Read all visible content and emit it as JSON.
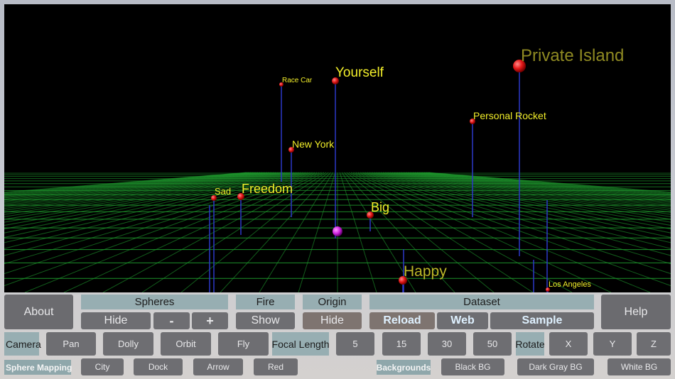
{
  "scene": {
    "spheres": [
      {
        "label": "Private Island",
        "color": "#8f8a22",
        "size": 24
      },
      {
        "label": "Yourself",
        "color": "#f2ee2a",
        "size": 19
      },
      {
        "label": "Race Car",
        "color": "#f2ee2a",
        "size": 10
      },
      {
        "label": "Personal Rocket",
        "color": "#f2ee2a",
        "size": 14
      },
      {
        "label": "New York",
        "color": "#f2ee2a",
        "size": 14
      },
      {
        "label": "Freedom",
        "color": "#f2ee2a",
        "size": 18
      },
      {
        "label": "Sad",
        "color": "#f2ee2a",
        "size": 13
      },
      {
        "label": "Big",
        "color": "#f2ee2a",
        "size": 18
      },
      {
        "label": "Happy",
        "color": "#bdb728",
        "size": 21
      },
      {
        "label": "Los Angeles",
        "color": "#f2ee2a",
        "size": 11
      }
    ],
    "colors": {
      "grid": "#1f9a2e",
      "stem": "#2c38c8",
      "sphere": "#e21818",
      "origin": "#cc22dd",
      "background": "#000000"
    }
  },
  "controls": {
    "about": "About",
    "help": "Help",
    "spheres": {
      "header": "Spheres",
      "hide": "Hide",
      "minus": "-",
      "plus": "+"
    },
    "fire": {
      "header": "Fire",
      "show": "Show"
    },
    "origin": {
      "header": "Origin",
      "hide": "Hide"
    },
    "dataset": {
      "header": "Dataset",
      "reload": "Reload",
      "web": "Web",
      "sample": "Sample"
    },
    "camera": {
      "header": "Camera",
      "pan": "Pan",
      "dolly": "Dolly",
      "orbit": "Orbit",
      "fly": "Fly"
    },
    "focal": {
      "header": "Focal Length",
      "options": [
        "5",
        "15",
        "30",
        "50"
      ]
    },
    "rotate": {
      "header": "Rotate",
      "x": "X",
      "y": "Y",
      "z": "Z"
    },
    "mapping": {
      "header": "Sphere Mapping",
      "city": "City",
      "dock": "Dock",
      "arrow": "Arrow",
      "red": "Red"
    },
    "backgrounds": {
      "header": "Backgrounds",
      "black": "Black BG",
      "darkgray": "Dark Gray BG",
      "white": "White BG"
    }
  }
}
